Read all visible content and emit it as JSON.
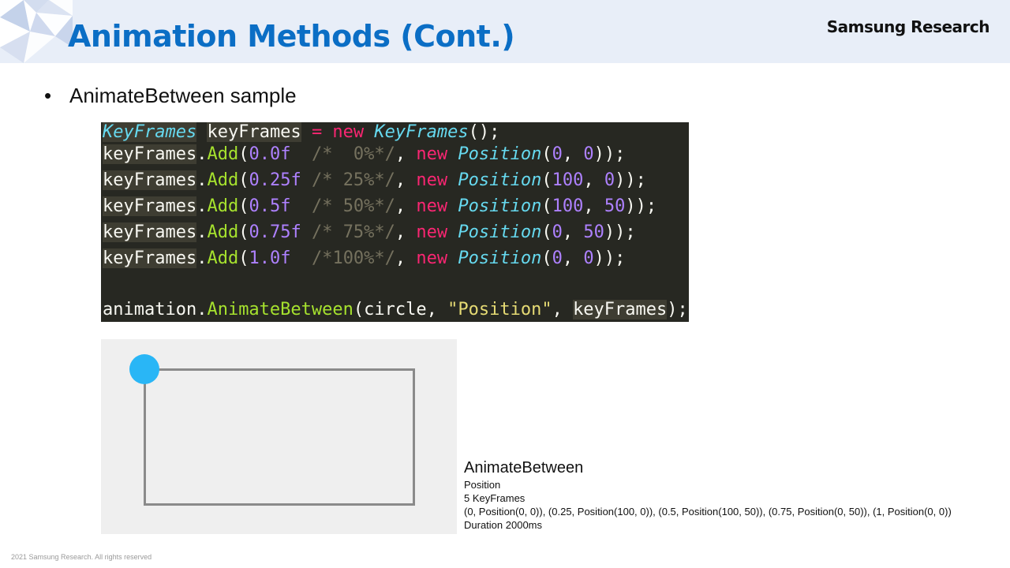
{
  "header": {
    "title": "Animation Methods (Cont.)",
    "brand": "Samsung Research"
  },
  "bullet": {
    "marker": "•",
    "text": "AnimateBetween sample"
  },
  "code": {
    "line1": {
      "a": "KeyFrames",
      "b": " ",
      "c": "keyFrames",
      "d": " ",
      "e": "= new",
      "f": " ",
      "g": "KeyFrames",
      "h": "();"
    },
    "rows": [
      {
        "obj": "keyFrames",
        "dot": ".",
        "fn": "Add",
        "p1": "(",
        "num": "0.0f",
        "gap": "  ",
        "cmt": "/*  0%*/",
        "sep": ", ",
        "kw": "new",
        "sp": " ",
        "type": "Position",
        "p2": "(",
        "x": "0",
        "comma": ", ",
        "y": "0",
        "end": "));"
      },
      {
        "obj": "keyFrames",
        "dot": ".",
        "fn": "Add",
        "p1": "(",
        "num": "0.25f",
        "gap": " ",
        "cmt": "/* 25%*/",
        "sep": ", ",
        "kw": "new",
        "sp": " ",
        "type": "Position",
        "p2": "(",
        "x": "100",
        "comma": ", ",
        "y": "0",
        "end": "));"
      },
      {
        "obj": "keyFrames",
        "dot": ".",
        "fn": "Add",
        "p1": "(",
        "num": "0.5f",
        "gap": "  ",
        "cmt": "/* 50%*/",
        "sep": ", ",
        "kw": "new",
        "sp": " ",
        "type": "Position",
        "p2": "(",
        "x": "100",
        "comma": ", ",
        "y": "50",
        "end": "));"
      },
      {
        "obj": "keyFrames",
        "dot": ".",
        "fn": "Add",
        "p1": "(",
        "num": "0.75f",
        "gap": " ",
        "cmt": "/* 75%*/",
        "sep": ", ",
        "kw": "new",
        "sp": " ",
        "type": "Position",
        "p2": "(",
        "x": "0",
        "comma": ", ",
        "y": "50",
        "end": "));"
      },
      {
        "obj": "keyFrames",
        "dot": ".",
        "fn": "Add",
        "p1": "(",
        "num": "1.0f",
        "gap": "  ",
        "cmt": "/*100%*/",
        "sep": ", ",
        "kw": "new",
        "sp": " ",
        "type": "Position",
        "p2": "(",
        "x": "0",
        "comma": ", ",
        "y": "0",
        "end": "));"
      }
    ],
    "call": {
      "a": "animation.",
      "b": "AnimateBetween",
      "c": "(circle, ",
      "d": "\"Position\"",
      "e": ", ",
      "f": "keyFrames",
      "g": ");"
    }
  },
  "info": {
    "title": "AnimateBetween",
    "property": "Position",
    "keyframes": "5 KeyFrames",
    "values": "(0, Position(0, 0)), (0.25, Position(100, 0)), (0.5, Position(100, 50)), (0.75, Position(0, 50)), (1, Position(0, 0))",
    "duration": "Duration 2000ms"
  },
  "footer": "2021 Samsung Research. All rights reserved",
  "colors": {
    "title": "#0b6ec5",
    "header_bg": "#e8eef8",
    "code_bg": "#272822",
    "ball": "#29b6f6",
    "demo_bg": "#efefef"
  }
}
